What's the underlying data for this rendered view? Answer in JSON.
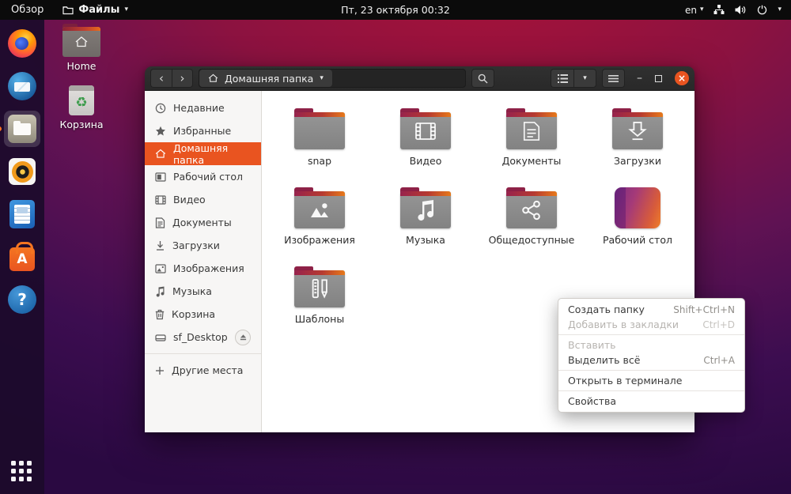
{
  "colors": {
    "accent": "#e95420",
    "close_button": "#e95420",
    "selection": "#e95420"
  },
  "glyphs": {
    "chevron_down": "▾",
    "back": "‹",
    "forward": "›",
    "minimize": "–",
    "close": "×",
    "question": "?",
    "software_a": "A",
    "recycle": "♻"
  },
  "topbar": {
    "activities": "Обзор",
    "app_name": "Файлы",
    "clock": "Пт, 23 октября  00:32",
    "keyboard_layout": "en"
  },
  "dock": {
    "items": [
      "firefox",
      "thunderbird",
      "files",
      "rhythmbox",
      "libreoffice-writer",
      "ubuntu-software",
      "help"
    ],
    "active_item": "files"
  },
  "desktop": {
    "icons": [
      {
        "label": "Home"
      },
      {
        "label": "Корзина"
      }
    ]
  },
  "window": {
    "location": "Домашняя папка",
    "sidebar": {
      "items": [
        {
          "label": "Недавние"
        },
        {
          "label": "Избранные"
        },
        {
          "label": "Домашняя папка",
          "selected": true
        },
        {
          "label": "Рабочий стол"
        },
        {
          "label": "Видео"
        },
        {
          "label": "Документы"
        },
        {
          "label": "Загрузки"
        },
        {
          "label": "Изображения"
        },
        {
          "label": "Музыка"
        },
        {
          "label": "Корзина"
        },
        {
          "label": "sf_Desktop"
        },
        {
          "label": "Другие места"
        }
      ]
    },
    "files": [
      {
        "name": "snap",
        "glyph": "none"
      },
      {
        "name": "Видео",
        "glyph": "film"
      },
      {
        "name": "Документы",
        "glyph": "document"
      },
      {
        "name": "Загрузки",
        "glyph": "download"
      },
      {
        "name": "Изображения",
        "glyph": "picture"
      },
      {
        "name": "Музыка",
        "glyph": "music"
      },
      {
        "name": "Общедоступные",
        "glyph": "share"
      },
      {
        "name": "Рабочий стол",
        "glyph": "desktop-gradient"
      },
      {
        "name": "Шаблоны",
        "glyph": "templates"
      }
    ]
  },
  "context_menu": {
    "items": [
      {
        "label": "Создать папку",
        "shortcut": "Shift+Ctrl+N",
        "enabled": true
      },
      {
        "label": "Добавить в закладки",
        "shortcut": "Ctrl+D",
        "enabled": false
      },
      {
        "label": "Вставить",
        "shortcut": "",
        "enabled": false
      },
      {
        "label": "Выделить всё",
        "shortcut": "Ctrl+A",
        "enabled": true
      },
      {
        "label": "Открыть в терминале",
        "shortcut": "",
        "enabled": true
      },
      {
        "label": "Свойства",
        "shortcut": "",
        "enabled": true
      }
    ]
  }
}
